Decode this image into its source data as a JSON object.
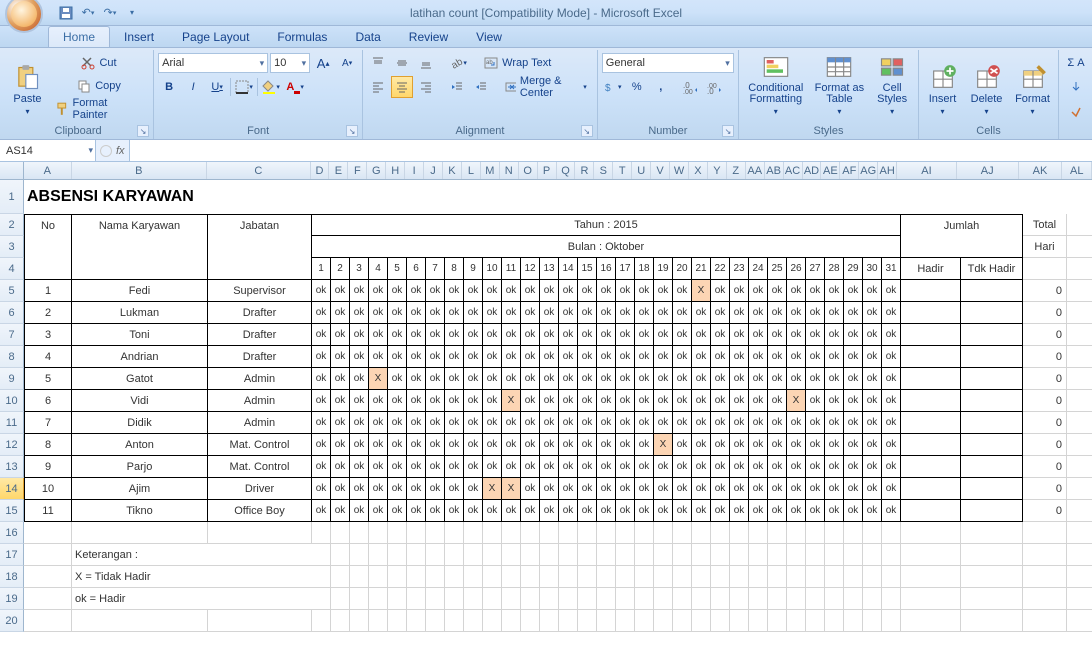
{
  "titlebar": {
    "title": "latihan count  [Compatibility Mode] - Microsoft Excel"
  },
  "tabs": [
    "Home",
    "Insert",
    "Page Layout",
    "Formulas",
    "Data",
    "Review",
    "View"
  ],
  "active_tab": "Home",
  "ribbon": {
    "clipboard": {
      "label": "Clipboard",
      "paste": "Paste",
      "cut": "Cut",
      "copy": "Copy",
      "fmtpainter": "Format Painter"
    },
    "font": {
      "label": "Font",
      "name": "Arial",
      "size": "10"
    },
    "alignment": {
      "label": "Alignment",
      "wrap": "Wrap Text",
      "merge": "Merge & Center"
    },
    "number": {
      "label": "Number",
      "format": "General"
    },
    "styles": {
      "label": "Styles",
      "cond": "Conditional Formatting",
      "fmttbl": "Format as Table",
      "cellst": "Cell Styles"
    },
    "cells": {
      "label": "Cells",
      "insert": "Insert",
      "delete": "Delete",
      "format": "Format"
    }
  },
  "namebox": "AS14",
  "columns": [
    {
      "l": "A",
      "w": 48
    },
    {
      "l": "B",
      "w": 136
    },
    {
      "l": "C",
      "w": 104
    },
    {
      "l": "D",
      "w": 19
    },
    {
      "l": "E",
      "w": 19
    },
    {
      "l": "F",
      "w": 19
    },
    {
      "l": "G",
      "w": 19
    },
    {
      "l": "H",
      "w": 19
    },
    {
      "l": "I",
      "w": 19
    },
    {
      "l": "J",
      "w": 19
    },
    {
      "l": "K",
      "w": 19
    },
    {
      "l": "L",
      "w": 19
    },
    {
      "l": "M",
      "w": 19
    },
    {
      "l": "N",
      "w": 19
    },
    {
      "l": "O",
      "w": 19
    },
    {
      "l": "P",
      "w": 19
    },
    {
      "l": "Q",
      "w": 19
    },
    {
      "l": "R",
      "w": 19
    },
    {
      "l": "S",
      "w": 19
    },
    {
      "l": "T",
      "w": 19
    },
    {
      "l": "U",
      "w": 19
    },
    {
      "l": "V",
      "w": 19
    },
    {
      "l": "W",
      "w": 19
    },
    {
      "l": "X",
      "w": 19
    },
    {
      "l": "Y",
      "w": 19
    },
    {
      "l": "Z",
      "w": 19
    },
    {
      "l": "AA",
      "w": 19
    },
    {
      "l": "AB",
      "w": 19
    },
    {
      "l": "AC",
      "w": 19
    },
    {
      "l": "AD",
      "w": 19
    },
    {
      "l": "AE",
      "w": 19
    },
    {
      "l": "AF",
      "w": 19
    },
    {
      "l": "AG",
      "w": 19
    },
    {
      "l": "AH",
      "w": 19
    },
    {
      "l": "AI",
      "w": 60
    },
    {
      "l": "AJ",
      "w": 62
    },
    {
      "l": "AK",
      "w": 44
    },
    {
      "l": "AL",
      "w": 30
    }
  ],
  "row_heights": {
    "1": 34,
    "default": 22
  },
  "sheet": {
    "title": "ABSENSI KARYAWAN",
    "header": {
      "no": "No",
      "nama": "Nama Karyawan",
      "jabatan": "Jabatan",
      "tahun": "Tahun : 2015",
      "bulan": "Bulan : Oktober",
      "jumlah": "Jumlah",
      "hadir": "Hadir",
      "tdk": "Tdk Hadir",
      "total": "Total",
      "hari": "Hari"
    },
    "days": [
      1,
      2,
      3,
      4,
      5,
      6,
      7,
      8,
      9,
      10,
      11,
      12,
      13,
      14,
      15,
      16,
      17,
      18,
      19,
      20,
      21,
      22,
      23,
      24,
      25,
      26,
      27,
      28,
      29,
      30,
      31
    ],
    "rows": [
      {
        "no": 1,
        "nama": "Fedi",
        "jab": "Supervisor",
        "att": [
          "ok",
          "ok",
          "ok",
          "ok",
          "ok",
          "ok",
          "ok",
          "ok",
          "ok",
          "ok",
          "ok",
          "ok",
          "ok",
          "ok",
          "ok",
          "ok",
          "ok",
          "ok",
          "ok",
          "ok",
          "X",
          "ok",
          "ok",
          "ok",
          "ok",
          "ok",
          "ok",
          "ok",
          "ok",
          "ok",
          "ok"
        ],
        "total": 0
      },
      {
        "no": 2,
        "nama": "Lukman",
        "jab": "Drafter",
        "att": [
          "ok",
          "ok",
          "ok",
          "ok",
          "ok",
          "ok",
          "ok",
          "ok",
          "ok",
          "ok",
          "ok",
          "ok",
          "ok",
          "ok",
          "ok",
          "ok",
          "ok",
          "ok",
          "ok",
          "ok",
          "ok",
          "ok",
          "ok",
          "ok",
          "ok",
          "ok",
          "ok",
          "ok",
          "ok",
          "ok",
          "ok"
        ],
        "total": 0
      },
      {
        "no": 3,
        "nama": "Toni",
        "jab": "Drafter",
        "att": [
          "ok",
          "ok",
          "ok",
          "ok",
          "ok",
          "ok",
          "ok",
          "ok",
          "ok",
          "ok",
          "ok",
          "ok",
          "ok",
          "ok",
          "ok",
          "ok",
          "ok",
          "ok",
          "ok",
          "ok",
          "ok",
          "ok",
          "ok",
          "ok",
          "ok",
          "ok",
          "ok",
          "ok",
          "ok",
          "ok",
          "ok"
        ],
        "total": 0
      },
      {
        "no": 4,
        "nama": "Andrian",
        "jab": "Drafter",
        "att": [
          "ok",
          "ok",
          "ok",
          "ok",
          "ok",
          "ok",
          "ok",
          "ok",
          "ok",
          "ok",
          "ok",
          "ok",
          "ok",
          "ok",
          "ok",
          "ok",
          "ok",
          "ok",
          "ok",
          "ok",
          "ok",
          "ok",
          "ok",
          "ok",
          "ok",
          "ok",
          "ok",
          "ok",
          "ok",
          "ok",
          "ok"
        ],
        "total": 0
      },
      {
        "no": 5,
        "nama": "Gatot",
        "jab": "Admin",
        "att": [
          "ok",
          "ok",
          "ok",
          "X",
          "ok",
          "ok",
          "ok",
          "ok",
          "ok",
          "ok",
          "ok",
          "ok",
          "ok",
          "ok",
          "ok",
          "ok",
          "ok",
          "ok",
          "ok",
          "ok",
          "ok",
          "ok",
          "ok",
          "ok",
          "ok",
          "ok",
          "ok",
          "ok",
          "ok",
          "ok",
          "ok"
        ],
        "total": 0
      },
      {
        "no": 6,
        "nama": "Vidi",
        "jab": "Admin",
        "att": [
          "ok",
          "ok",
          "ok",
          "ok",
          "ok",
          "ok",
          "ok",
          "ok",
          "ok",
          "ok",
          "X",
          "ok",
          "ok",
          "ok",
          "ok",
          "ok",
          "ok",
          "ok",
          "ok",
          "ok",
          "ok",
          "ok",
          "ok",
          "ok",
          "ok",
          "X",
          "ok",
          "ok",
          "ok",
          "ok",
          "ok"
        ],
        "total": 0
      },
      {
        "no": 7,
        "nama": "Didik",
        "jab": "Admin",
        "att": [
          "ok",
          "ok",
          "ok",
          "ok",
          "ok",
          "ok",
          "ok",
          "ok",
          "ok",
          "ok",
          "ok",
          "ok",
          "ok",
          "ok",
          "ok",
          "ok",
          "ok",
          "ok",
          "ok",
          "ok",
          "ok",
          "ok",
          "ok",
          "ok",
          "ok",
          "ok",
          "ok",
          "ok",
          "ok",
          "ok",
          "ok"
        ],
        "total": 0
      },
      {
        "no": 8,
        "nama": "Anton",
        "jab": "Mat. Control",
        "att": [
          "ok",
          "ok",
          "ok",
          "ok",
          "ok",
          "ok",
          "ok",
          "ok",
          "ok",
          "ok",
          "ok",
          "ok",
          "ok",
          "ok",
          "ok",
          "ok",
          "ok",
          "ok",
          "X",
          "ok",
          "ok",
          "ok",
          "ok",
          "ok",
          "ok",
          "ok",
          "ok",
          "ok",
          "ok",
          "ok",
          "ok"
        ],
        "total": 0
      },
      {
        "no": 9,
        "nama": "Parjo",
        "jab": "Mat. Control",
        "att": [
          "ok",
          "ok",
          "ok",
          "ok",
          "ok",
          "ok",
          "ok",
          "ok",
          "ok",
          "ok",
          "ok",
          "ok",
          "ok",
          "ok",
          "ok",
          "ok",
          "ok",
          "ok",
          "ok",
          "ok",
          "ok",
          "ok",
          "ok",
          "ok",
          "ok",
          "ok",
          "ok",
          "ok",
          "ok",
          "ok",
          "ok"
        ],
        "total": 0
      },
      {
        "no": 10,
        "nama": "Ajim",
        "jab": "Driver",
        "att": [
          "ok",
          "ok",
          "ok",
          "ok",
          "ok",
          "ok",
          "ok",
          "ok",
          "ok",
          "X",
          "X",
          "ok",
          "ok",
          "ok",
          "ok",
          "ok",
          "ok",
          "ok",
          "ok",
          "ok",
          "ok",
          "ok",
          "ok",
          "ok",
          "ok",
          "ok",
          "ok",
          "ok",
          "ok",
          "ok",
          "ok"
        ],
        "total": 0
      },
      {
        "no": 11,
        "nama": "Tikno",
        "jab": "Office Boy",
        "att": [
          "ok",
          "ok",
          "ok",
          "ok",
          "ok",
          "ok",
          "ok",
          "ok",
          "ok",
          "ok",
          "ok",
          "ok",
          "ok",
          "ok",
          "ok",
          "ok",
          "ok",
          "ok",
          "ok",
          "ok",
          "ok",
          "ok",
          "ok",
          "ok",
          "ok",
          "ok",
          "ok",
          "ok",
          "ok",
          "ok",
          "ok"
        ],
        "total": 0
      }
    ],
    "keterangan": {
      "title": "Keterangan :",
      "x": "X = Tidak Hadir",
      "ok": "ok = Hadir"
    }
  }
}
